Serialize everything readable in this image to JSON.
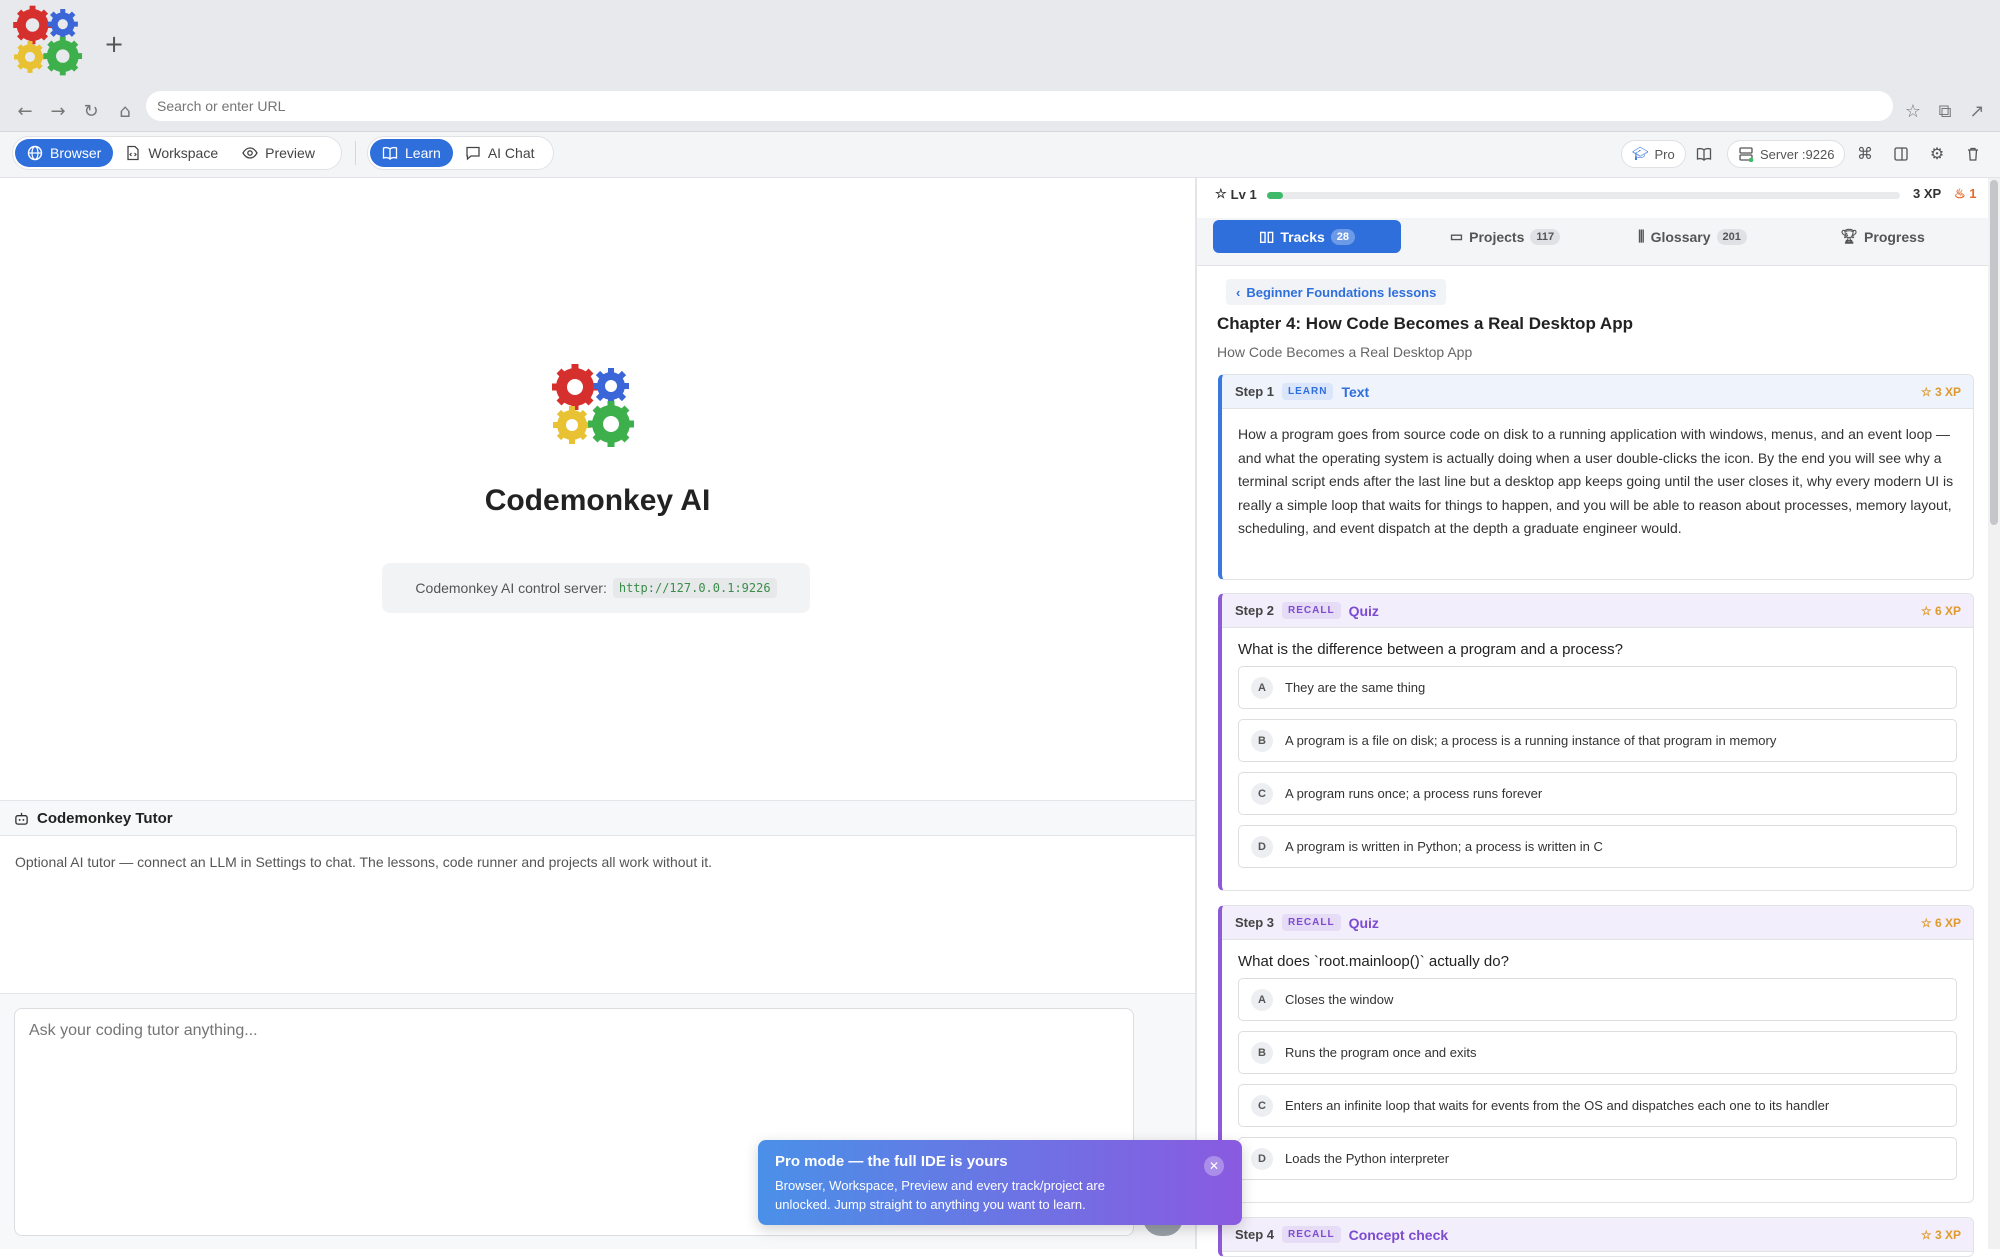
{
  "browser": {
    "url_placeholder": "Search or enter URL"
  },
  "toolbar": {
    "modes": [
      "Browser",
      "Workspace",
      "Preview"
    ],
    "learn_label": "Learn",
    "chat_label": "AI Chat",
    "pro_label": "Pro",
    "server_label": "Server :9226"
  },
  "home": {
    "title": "Codemonkey AI",
    "server_text": "Codemonkey AI control server:",
    "server_url": "http://127.0.0.1:9226"
  },
  "tutor": {
    "title": "Codemonkey Tutor",
    "message": "Optional AI tutor — connect an LLM in Settings to chat. The lessons, code runner and projects all work without it.",
    "input_placeholder": "Ask your coding tutor anything..."
  },
  "toast": {
    "title": "Pro mode — the full IDE is yours",
    "body": "Browser, Workspace, Preview and every track/project are unlocked. Jump straight to anything you want to learn."
  },
  "progress": {
    "level": "Lv 1",
    "xp": "3 XP",
    "streak": "1",
    "xp_fraction": 0.025
  },
  "tabs": [
    {
      "label": "Tracks",
      "count": "28"
    },
    {
      "label": "Projects",
      "count": "117"
    },
    {
      "label": "Glossary",
      "count": "201"
    },
    {
      "label": "Progress",
      "count": ""
    }
  ],
  "lesson": {
    "back_label": "Beginner Foundations lessons",
    "chapter_title": "Chapter 4: How Code Becomes a Real Desktop App",
    "chapter_subtitle": "How Code Becomes a Real Desktop App",
    "steps": [
      {
        "num": "Step 1",
        "kind": "LEARN",
        "type": "Text",
        "xp": "3 XP",
        "text": "How a program goes from source code on disk to a running application with windows, menus, and an event loop — and what the operating system is actually doing when a user double-clicks the icon. By the end you will see why a terminal script ends after the last line but a desktop app keeps going until the user closes it, why every modern UI is really a simple loop that waits for things to happen, and you will be able to reason about processes, memory layout, scheduling, and event dispatch at the depth a graduate engineer would."
      },
      {
        "num": "Step 2",
        "kind": "RECALL",
        "type": "Quiz",
        "xp": "6 XP",
        "question": "What is the difference between a program and a process?",
        "options": [
          {
            "letter": "A",
            "text": "They are the same thing"
          },
          {
            "letter": "B",
            "text": "A program is a file on disk; a process is a running instance of that program in memory"
          },
          {
            "letter": "C",
            "text": "A program runs once; a process runs forever"
          },
          {
            "letter": "D",
            "text": "A program is written in Python; a process is written in C"
          }
        ]
      },
      {
        "num": "Step 3",
        "kind": "RECALL",
        "type": "Quiz",
        "xp": "6 XP",
        "question": "What does `root.mainloop()` actually do?",
        "options": [
          {
            "letter": "A",
            "text": "Closes the window"
          },
          {
            "letter": "B",
            "text": "Runs the program once and exits"
          },
          {
            "letter": "C",
            "text": "Enters an infinite loop that waits for events from the OS and dispatches each one to its handler"
          },
          {
            "letter": "D",
            "text": "Loads the Python interpreter"
          }
        ]
      },
      {
        "num": "Step 4",
        "kind": "RECALL",
        "type": "Concept check",
        "xp": "3 XP"
      }
    ]
  },
  "colors": {
    "accent": "#2f6fdc",
    "recall": "#7c4bd0",
    "xp_bar": "#3fb96a",
    "xp_gold": "#e09a2c"
  }
}
